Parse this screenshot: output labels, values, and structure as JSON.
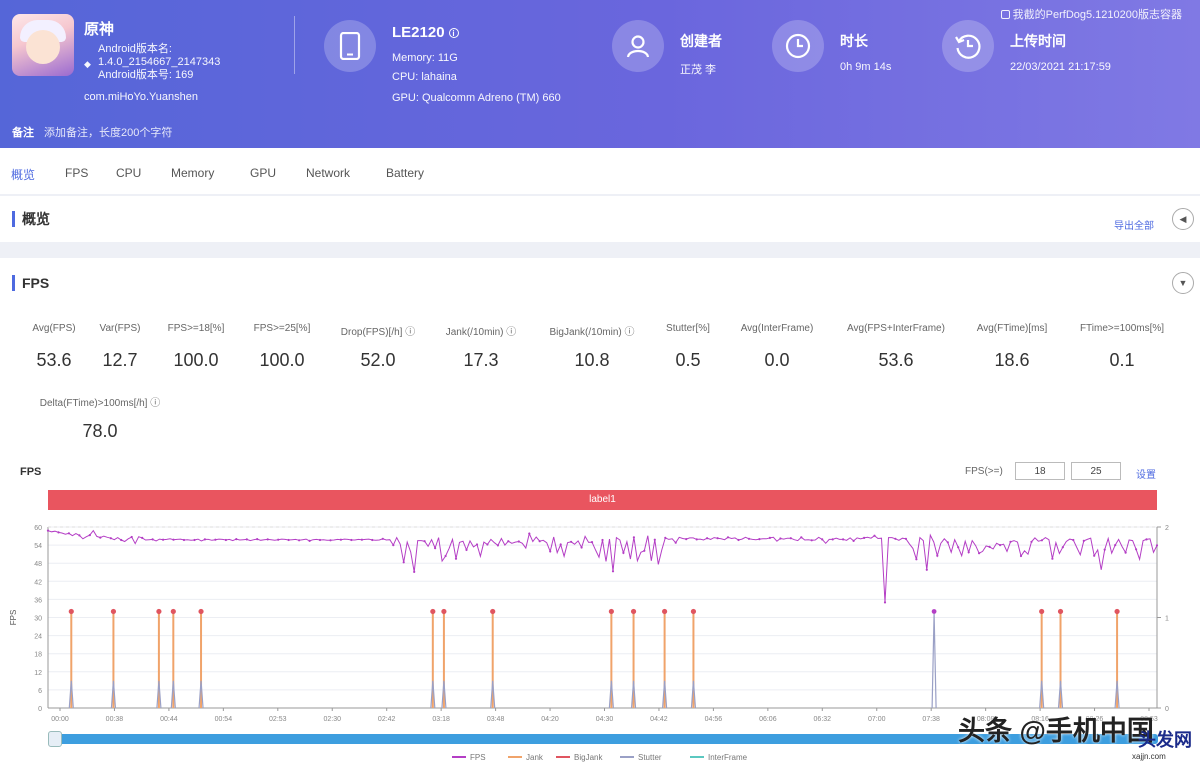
{
  "header": {
    "top_note": "我截的PerfDog5.1210200版志容器",
    "game": {
      "name": "原神",
      "version_label": "Android版本名:",
      "version_value": "1.4.0_2154667_2147343",
      "version_code": "Android版本号: 169",
      "package": "com.miHoYo.Yuanshen"
    },
    "device": {
      "model": "LE2120",
      "memory": "Memory: 11G",
      "cpu": "CPU: lahaina",
      "gpu": "GPU: Qualcomm Adreno (TM) 660"
    },
    "creator": {
      "label": "创建者",
      "value": "正茂 李"
    },
    "duration": {
      "label": "时长",
      "value": "0h 9m 14s"
    },
    "upload": {
      "label": "上传时间",
      "value": "22/03/2021 21:17:59"
    },
    "remark": {
      "label": "备注",
      "placeholder": "添加备注，长度200个字符"
    }
  },
  "tabs": [
    "概览",
    "FPS",
    "CPU",
    "Memory",
    "GPU",
    "Network",
    "Battery"
  ],
  "overview": {
    "title": "概览",
    "export": "导出全部"
  },
  "fps_section": {
    "title": "FPS",
    "metrics": [
      {
        "label": "Avg(FPS)",
        "value": "53.6"
      },
      {
        "label": "Var(FPS)",
        "value": "12.7"
      },
      {
        "label": "FPS>=18[%]",
        "value": "100.0"
      },
      {
        "label": "FPS>=25[%]",
        "value": "100.0"
      },
      {
        "label": "Drop(FPS)[/h] ⓘ",
        "value": "52.0"
      },
      {
        "label": "Jank(/10min) ⓘ",
        "value": "17.3"
      },
      {
        "label": "BigJank(/10min) ⓘ",
        "value": "10.8"
      },
      {
        "label": "Stutter[%]",
        "value": "0.5"
      },
      {
        "label": "Avg(InterFrame)",
        "value": "0.0"
      },
      {
        "label": "Avg(FPS+InterFrame)",
        "value": "53.6"
      },
      {
        "label": "Avg(FTime)[ms]",
        "value": "18.6"
      },
      {
        "label": "FTime>=100ms[%]",
        "value": "0.1"
      },
      {
        "label": "Delta(FTime)>100ms[/h] ⓘ",
        "value": "78.0"
      }
    ]
  },
  "chart_data": {
    "type": "line",
    "title": "FPS",
    "label_bar": "label1",
    "range_label": "FPS(>=)",
    "range_low": "18",
    "range_high": "25",
    "range_button": "设置",
    "ylabel_left": "FPS",
    "y_ticks_left": [
      "0",
      "6",
      "12",
      "18",
      "24",
      "30",
      "36",
      "42",
      "48",
      "54",
      "60"
    ],
    "y_ticks_right": [
      "0",
      "1",
      "2"
    ],
    "ylim_left": [
      0,
      60
    ],
    "ylim_right": [
      0,
      2
    ],
    "x_ticks": [
      "00:00",
      "00:38",
      "00:44",
      "00:54",
      "02:53",
      "02:30",
      "02:42",
      "03:18",
      "03:48",
      "04:20",
      "04:30",
      "04:42",
      "04:56",
      "06:06",
      "06:32",
      "07:00",
      "07:38",
      "08:08",
      "08:16",
      "08:26",
      "08:53"
    ],
    "colors": {
      "fps": "#b43ec5",
      "jank": "#f0a36a",
      "bigjank": "#e05560",
      "stutter": "#9aa0c6",
      "interframe": "#5bc8c0"
    },
    "series": [
      {
        "name": "FPS",
        "values": [
          58.8,
          58.4,
          58.6,
          58.2,
          58,
          57.6,
          57.9,
          57.1,
          57.8,
          57.2,
          56.1,
          56.8,
          57.3,
          58.8,
          56.9,
          56.5,
          57,
          56.6,
          56.3,
          55.8,
          56.5,
          55.7,
          55.2,
          56.1,
          56.7,
          54.5,
          56.8,
          56.4,
          55.7,
          55.8,
          55.9,
          55.4,
          56,
          55.8,
          55.9,
          56.1,
          55.8,
          55.9,
          56,
          55.7,
          55.8,
          55.6,
          55.7,
          56,
          55.4,
          55.9,
          55.9,
          55.6,
          55.8,
          56,
          55.9,
          55.7,
          55.9,
          55.5,
          56,
          55.7,
          55.8,
          55.9,
          55.5,
          55.8,
          56,
          55.6,
          55.8,
          55.9,
          55.8,
          55.6,
          55.8,
          56,
          55.9,
          55.7,
          55.8,
          55.9,
          55.6,
          55.8,
          56,
          55.4,
          55.8,
          55.9,
          55.7,
          55.8,
          55.6,
          55.6,
          55.7,
          55.9,
          55.8,
          56,
          55.9,
          55.7,
          55.7,
          55.9,
          55.8,
          55.9,
          56,
          55.7,
          55.6,
          55.7,
          56.1,
          55.7,
          55.8,
          54,
          56.5,
          54.3,
          48.3,
          55,
          51.7,
          45.1,
          55.5,
          55.5,
          55.3,
          53.6,
          55.8,
          53,
          56.5,
          48.7,
          50.4,
          52.9,
          55.9,
          49.5,
          54.9,
          55.3,
          52.4,
          55.4,
          53.4,
          54.2,
          50.3,
          55,
          54.2,
          55.9,
          54.8,
          53.9,
          56.2,
          54,
          55.3,
          54.6,
          55,
          55.2,
          54.6,
          53,
          57.8,
          55.2,
          56.7,
          55.3,
          55.6,
          54.8,
          51.9,
          56.7,
          51.5,
          54.2,
          50.3,
          54.8,
          55.1,
          54.3,
          55.4,
          53.2,
          56.9,
          54.9,
          55,
          52.4,
          50,
          55.7,
          48.6,
          56,
          45.3,
          56.5,
          55.7,
          51.4,
          55.1,
          49.4,
          56.6,
          48.8,
          51.6,
          52.1,
          57.1,
          48.8,
          55.8,
          47.6,
          52.4,
          56.4,
          55.9,
          56.1,
          54.8,
          56.6,
          56.2,
          56,
          56.4,
          56.4,
          55.9,
          56,
          55.7,
          56.3,
          55.9,
          56.5,
          56.3,
          56.1,
          55.8,
          56.6,
          56.2,
          56.4,
          55.7,
          56,
          56.6,
          56.1,
          55.9,
          55.8,
          56,
          56.1,
          56.1,
          56.4,
          56.6,
          55.3,
          56.2,
          56,
          56.3,
          56.3,
          55.8,
          55.5,
          56.6,
          55.7,
          55.8,
          55.6,
          55.7,
          56.6,
          55.9,
          54.6,
          55.9,
          55.9,
          56.3,
          55.9,
          55.9,
          55.6,
          56.4,
          55.4,
          56.4,
          56.1,
          56.4,
          56.6,
          56.3,
          57.1,
          56.2,
          56.3,
          35,
          56.5,
          56.5,
          56.1,
          55.6,
          56.3,
          56.1,
          54.4,
          52.9,
          49.3,
          56.5,
          55.5,
          45.8,
          57.3,
          55,
          50.5,
          54.6,
          56.1,
          54.9,
          51.6,
          55.8,
          53.3,
          50.5,
          55.3,
          51.6,
          55.5,
          53.8,
          51.3,
          51.9,
          53.7,
          53.4,
          52.7,
          54.6,
          54,
          54.3,
          51.9,
          55.1,
          55.5,
          55,
          50.4,
          52.1,
          51,
          55.1,
          56.4,
          55.3,
          55.6,
          56.5,
          55.8,
          49.5,
          54.8,
          51.2,
          53.3,
          55.2,
          56,
          55.7,
          53.2,
          50.8,
          55.4,
          55.9,
          56.3,
          50.5,
          52.4,
          45.8,
          52.5,
          56.2,
          51.3,
          54,
          55.9,
          53.5,
          51.5,
          55.7,
          55.5,
          52.6,
          49.3,
          55.5,
          55.9,
          56.1,
          51.6,
          53.9
        ]
      },
      {
        "name": "Jank",
        "values": []
      },
      {
        "name": "BigJank",
        "values": []
      },
      {
        "name": "Stutter",
        "values": []
      },
      {
        "name": "InterFrame",
        "values": []
      }
    ],
    "spike_positions": [
      0.021,
      0.059,
      0.1,
      0.113,
      0.138,
      0.347,
      0.357,
      0.401,
      0.508,
      0.528,
      0.556,
      0.582,
      0.799,
      0.896,
      0.913,
      0.964
    ],
    "spike_heights": [
      32,
      32,
      32,
      32,
      32,
      32,
      32,
      32,
      32,
      32,
      32,
      32,
      1,
      32,
      32,
      32
    ],
    "legend": [
      "FPS",
      "Jank",
      "BigJank",
      "Stutter",
      "InterFrame"
    ]
  },
  "watermark": {
    "text": "头条 @手机中国",
    "logo": "头发网",
    "site": "xajjn.com"
  }
}
